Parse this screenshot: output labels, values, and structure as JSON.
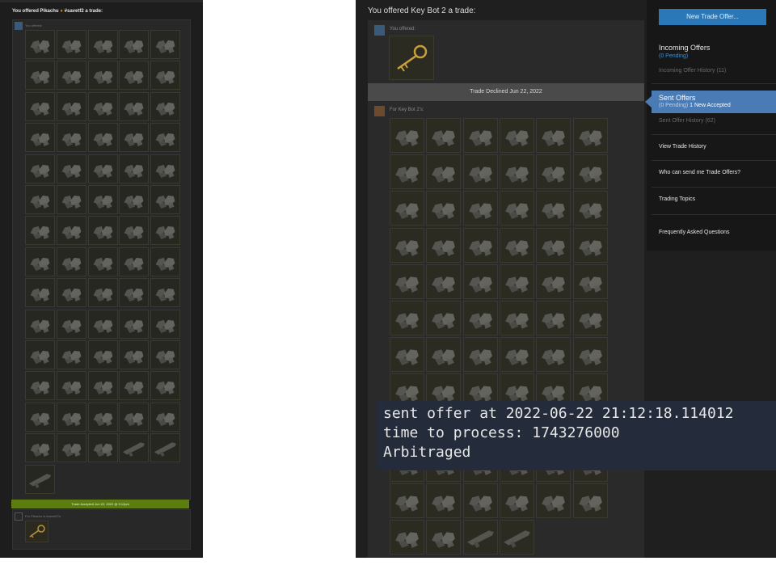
{
  "left_panel": {
    "title": "You offered Pikachu",
    "tag": "#savetf2 a trade:",
    "you_offered": "You offered:",
    "accepted_banner": "Trade Accepted Jun 22, 2022 @ 9:12pm",
    "for_label": "For Pikachu ♦ #savetf2's:"
  },
  "right_panel": {
    "title": "You offered Key Bot 2 a trade:",
    "you_offered": "You offered:",
    "declined_banner": "Trade Declined Jun 22, 2022",
    "for_label": "For Key Bot 2's:"
  },
  "console": {
    "line1": "sent offer at 2022-06-22 21:12:18.114012",
    "line2": "time to process: 1743276000",
    "line3": "Arbitraged"
  },
  "sidebar": {
    "new_trade_offer": "New Trade Offer...",
    "incoming_title": "Incoming Offers",
    "incoming_pending": "(0 Pending)",
    "incoming_history": "Incoming Offer History (11)",
    "sent_title": "Sent Offers",
    "sent_pending": "(0 Pending)",
    "sent_new_accepted": "1 New Accepted",
    "sent_history": "Sent Offer History (62)",
    "view_trade_history": "View Trade History",
    "who_can_send": "Who can send me Trade Offers?",
    "trading_topics": "Trading Topics",
    "faq": "Frequently Asked Questions"
  },
  "colors": {
    "accepted_banner": "#5c7e10",
    "declined_banner": "#4a4a4a",
    "new_offer_button": "#2a78b8",
    "selected_item": "#4a7bb5",
    "pending_text": "#4a8ccc"
  },
  "icons": {
    "item_pile": "metal-scrap-icon",
    "key": "key-icon",
    "weapon": "weapon-icon"
  }
}
